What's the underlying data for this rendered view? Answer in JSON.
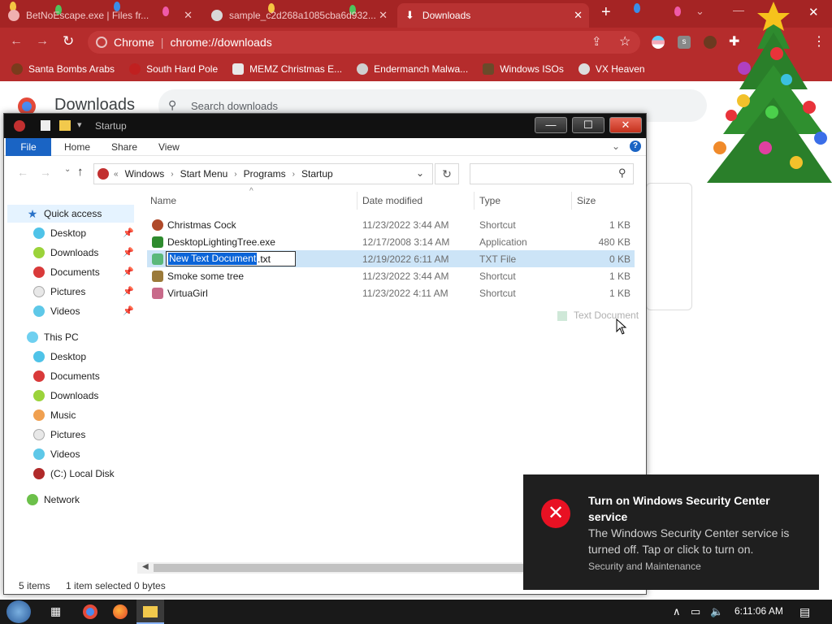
{
  "browser": {
    "tabs": [
      {
        "label": "BetNoEscape.exe | Files fr...",
        "active": false
      },
      {
        "label": "sample_c2d268a1085cba6d932...",
        "active": false
      },
      {
        "label": "Downloads",
        "active": true
      }
    ],
    "omnibox": {
      "site": "Chrome",
      "url": "chrome://downloads"
    },
    "bookmarks": [
      "Santa Bombs Arabs",
      "South Hard Pole",
      "MEMZ Christmas E...",
      "Endermanch Malwa...",
      "Windows ISOs",
      "VX Heaven"
    ],
    "accent": "#b52c2c"
  },
  "downloads_page": {
    "title": "Downloads",
    "search_placeholder": "Search downloads"
  },
  "explorer": {
    "window_title": "Startup",
    "ribbon_tabs": [
      "File",
      "Home",
      "Share",
      "View"
    ],
    "breadcrumb": [
      "Windows",
      "Start Menu",
      "Programs",
      "Startup"
    ],
    "nav": {
      "quick_access": {
        "label": "Quick access",
        "items": [
          "Desktop",
          "Downloads",
          "Documents",
          "Pictures",
          "Videos"
        ]
      },
      "this_pc": {
        "label": "This PC",
        "items": [
          "Desktop",
          "Documents",
          "Downloads",
          "Music",
          "Pictures",
          "Videos",
          "(C:) Local Disk"
        ]
      },
      "network": "Network"
    },
    "columns": [
      "Name",
      "Date modified",
      "Type",
      "Size"
    ],
    "files": [
      {
        "name": "Christmas Cock",
        "date": "11/23/2022 3:44 AM",
        "type": "Shortcut",
        "size": "1 KB",
        "selected": false
      },
      {
        "name": "DesktopLightingTree.exe",
        "date": "12/17/2008 3:14 AM",
        "type": "Application",
        "size": "480 KB",
        "selected": false
      },
      {
        "name": "New Text Document.txt",
        "date": "12/19/2022 6:11 AM",
        "type": "TXT File",
        "size": "0 KB",
        "selected": true
      },
      {
        "name": "Smoke some tree",
        "date": "11/23/2022 3:44 AM",
        "type": "Shortcut",
        "size": "1 KB",
        "selected": false
      },
      {
        "name": "VirtuaGirl",
        "date": "11/23/2022 4:11 AM",
        "type": "Shortcut",
        "size": "1 KB",
        "selected": false
      }
    ],
    "rename": {
      "selected_text": "New Text Document",
      "extension": ".txt"
    },
    "drag_ghost": "Text Document",
    "status": {
      "count": "5 items",
      "selection": "1 item selected 0 bytes"
    }
  },
  "toast": {
    "title": "Turn on Windows Security Center service",
    "body": "The Windows Security Center service is turned off. Tap or click to turn on.",
    "source": "Security and Maintenance"
  },
  "taskbar": {
    "clock": "6:11:06 AM"
  }
}
